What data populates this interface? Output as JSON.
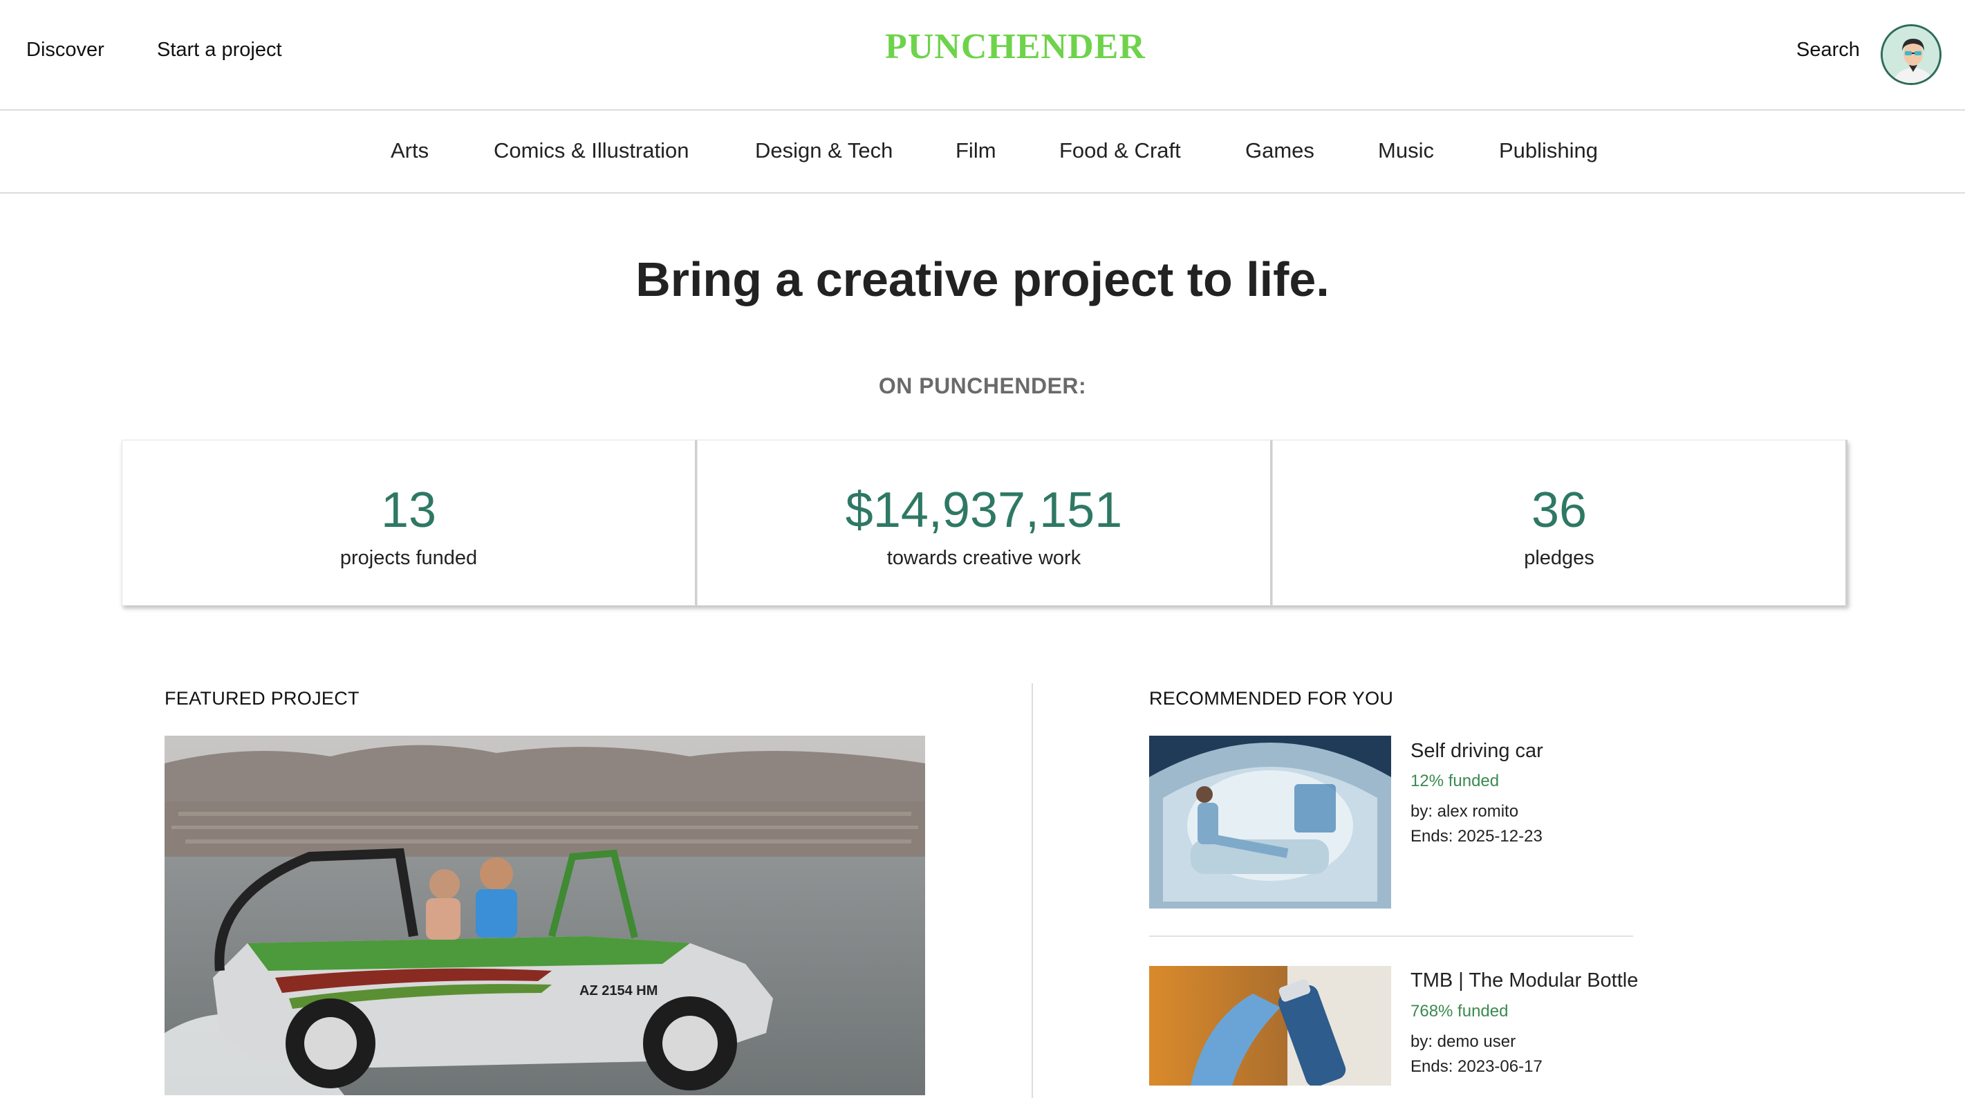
{
  "header": {
    "discover_label": "Discover",
    "start_project_label": "Start a project",
    "logo": "PUNCHENDER",
    "search_label": "Search"
  },
  "categories": [
    "Arts",
    "Comics & Illustration",
    "Design & Tech",
    "Film",
    "Food & Craft",
    "Games",
    "Music",
    "Publishing"
  ],
  "hero": {
    "title": "Bring a creative project to life.",
    "on_label": "ON PUNCHENDER:"
  },
  "stats": [
    {
      "value": "13",
      "label": "projects funded"
    },
    {
      "value": "$14,937,151",
      "label": "towards creative work"
    },
    {
      "value": "36",
      "label": "pledges"
    }
  ],
  "featured": {
    "label": "FEATURED PROJECT"
  },
  "recommended": {
    "label": "RECOMMENDED FOR YOU",
    "items": [
      {
        "title": "Self driving car",
        "funded": "12% funded",
        "by": "by: alex romito",
        "ends": "Ends: 2025-12-23"
      },
      {
        "title": "TMB | The Modular Bottle",
        "funded": "768% funded",
        "by": "by: demo user",
        "ends": "Ends: 2023-06-17"
      }
    ]
  },
  "colors": {
    "logo": "#6ed34b",
    "stat_value": "#2e7864",
    "funded": "#3a8a50"
  }
}
